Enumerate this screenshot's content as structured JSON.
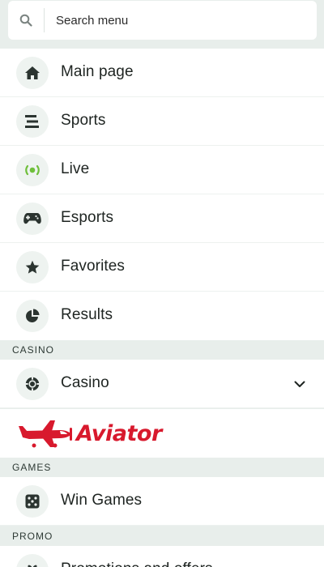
{
  "search": {
    "placeholder": "Search menu",
    "icon": "search-icon"
  },
  "menu": [
    {
      "label": "Main page",
      "icon": "home-icon"
    },
    {
      "label": "Sports",
      "icon": "list-icon"
    },
    {
      "label": "Live",
      "icon": "live-icon"
    },
    {
      "label": "Esports",
      "icon": "gamepad-icon"
    },
    {
      "label": "Favorites",
      "icon": "star-icon"
    },
    {
      "label": "Results",
      "icon": "pie-chart-icon"
    }
  ],
  "sections": {
    "casino": "CASINO",
    "games": "GAMES",
    "promo": "PROMO"
  },
  "casino_item": {
    "label": "Casino",
    "icon": "chip-icon",
    "expand_icon": "chevron-down-icon"
  },
  "aviator": {
    "logo_text": "Aviator"
  },
  "games_item": {
    "label": "Win Games",
    "icon": "dice-icon"
  },
  "promo_item": {
    "label": "Promotions and offers",
    "icon": "gift-icon"
  },
  "colors": {
    "accent_green": "#6fbf3b",
    "brand_red": "#d8192d",
    "background": "#e8eeeb"
  }
}
